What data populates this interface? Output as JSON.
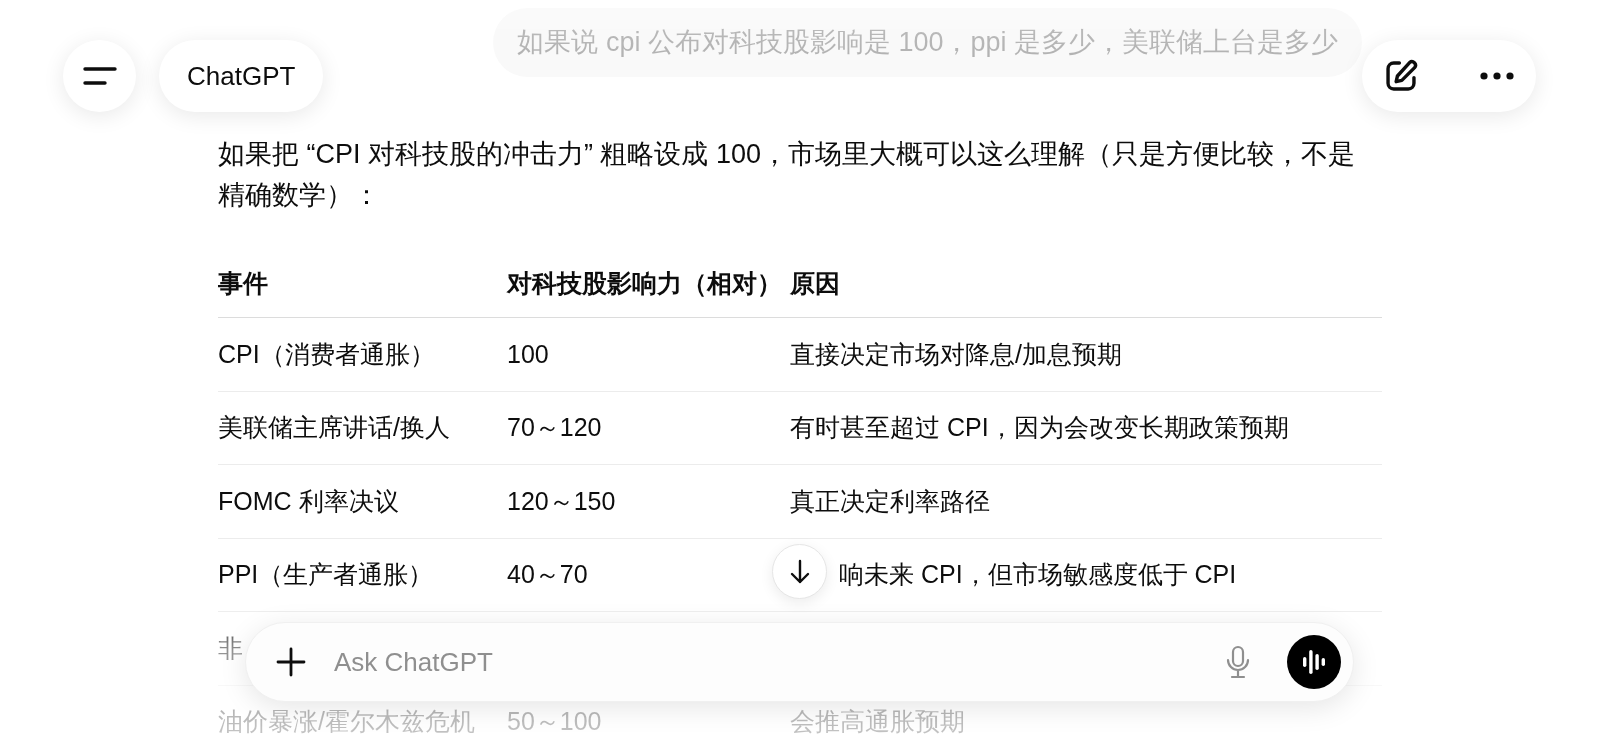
{
  "header": {
    "title": "ChatGPT"
  },
  "user_message": {
    "text": "如果说 cpi 公布对科技股影响是 100，ppi 是多少，美联储上台是多少"
  },
  "answer": {
    "intro": "如果把 “CPI 对科技股的冲击力” 粗略设成 100，市场里大概可以这么理解（只是方便比较，不是精确数学）：",
    "table": {
      "columns": [
        "事件",
        "对科技股影响力（相对）",
        "原因"
      ],
      "rows": [
        [
          "CPI（消费者通胀）",
          "100",
          "直接决定市场对降息/加息预期"
        ],
        [
          "美联储主席讲话/换人",
          "70～120",
          "有时甚至超过 CPI，因为会改变长期政策预期"
        ],
        [
          "FOMC 利率决议",
          "120～150",
          "真正决定利率路径"
        ],
        [
          "PPI（生产者通胀）",
          "40～70",
          "响未来 CPI，但市场敏感度低于 CPI"
        ],
        [
          "非"
        ],
        [
          "油价暴涨/霍尔木兹危机",
          "50～100",
          "会推高通胀预期"
        ]
      ]
    }
  },
  "composer": {
    "placeholder": "Ask ChatGPT"
  }
}
